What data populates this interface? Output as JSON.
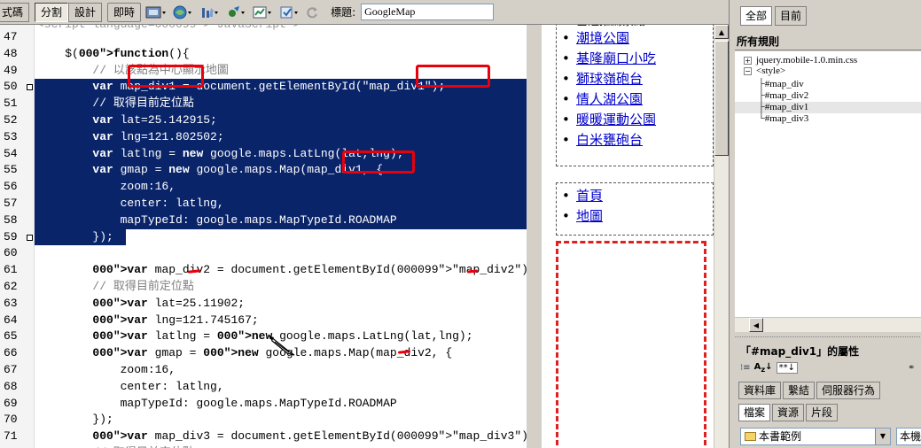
{
  "toolbar": {
    "tabs": [
      "式碼",
      "分割",
      "設計",
      "即時"
    ],
    "active_tab": "分割",
    "icons": [
      "preview-icon",
      "browser-check-icon",
      "file-management-icon",
      "debug-icon",
      "visual-aids-icon",
      "validate-icon",
      "refresh-icon"
    ],
    "title_label": "標題:",
    "title_value": "GoogleMap"
  },
  "code": {
    "cut_top_line": "<script language=\"JavaScript\">",
    "lines": [
      {
        "n": "47",
        "text": ""
      },
      {
        "n": "48",
        "text": "    $(function(){"
      },
      {
        "n": "49",
        "text": "        // 以該點為中心顯示地圖"
      },
      {
        "n": "50",
        "text": "        var map_div1 = document.getElementById(\"map_div1\");"
      },
      {
        "n": "51",
        "text": "        // 取得目前定位點"
      },
      {
        "n": "52",
        "text": "        var lat=25.142915;"
      },
      {
        "n": "53",
        "text": "        var lng=121.802502;"
      },
      {
        "n": "54",
        "text": "        var latlng = new google.maps.LatLng(lat,lng);"
      },
      {
        "n": "55",
        "text": "        var gmap = new google.maps.Map(map_div1, {"
      },
      {
        "n": "56",
        "text": "            zoom:16,"
      },
      {
        "n": "57",
        "text": "            center: latlng,"
      },
      {
        "n": "58",
        "text": "            mapTypeId: google.maps.MapTypeId.ROADMAP"
      },
      {
        "n": "59",
        "text": "        });"
      },
      {
        "n": "60",
        "text": ""
      },
      {
        "n": "61",
        "text": "        var map_div2 = document.getElementById(\"map_div2\");"
      },
      {
        "n": "62",
        "text": "        // 取得目前定位點"
      },
      {
        "n": "63",
        "text": "        var lat=25.11902;"
      },
      {
        "n": "64",
        "text": "        var lng=121.745167;"
      },
      {
        "n": "65",
        "text": "        var latlng = new google.maps.LatLng(lat,lng);"
      },
      {
        "n": "66",
        "text": "        var gmap = new google.maps.Map(map_div2, {"
      },
      {
        "n": "67",
        "text": "            zoom:16,"
      },
      {
        "n": "68",
        "text": "            center: latlng,"
      },
      {
        "n": "69",
        "text": "            mapTypeId: google.maps.MapTypeId.ROADMAP"
      },
      {
        "n": "70",
        "text": "        });"
      },
      {
        "n": "71",
        "text": "        var map_div3 = document.getElementById(\"map_div3\");"
      },
      {
        "n": "72",
        "text": "        // 取得目前定位點"
      }
    ],
    "selected_lines": [
      "50",
      "51",
      "52",
      "53",
      "54",
      "55",
      "56",
      "57",
      "58",
      "59"
    ]
  },
  "design": {
    "list1": [
      "基隆推薦景點",
      "潮境公園",
      "基隆廟口小吃",
      "獅球嶺砲台",
      "情人湖公園",
      "暖暖運動公園",
      "白米甕砲台"
    ],
    "list2": [
      "首頁",
      "地圖"
    ]
  },
  "panel": {
    "tabs": [
      "全部",
      "目前"
    ],
    "active_tab": "全部",
    "rules_header": "所有規則",
    "tree": [
      {
        "label": "jquery.mobile-1.0.min.css",
        "level": 0,
        "toggle": "+"
      },
      {
        "label": "<style>",
        "level": 0,
        "toggle": "-"
      },
      {
        "label": "#map_div",
        "level": 1
      },
      {
        "label": "#map_div2",
        "level": 1
      },
      {
        "label": "#map_div1",
        "level": 1,
        "selected": true
      },
      {
        "label": "#map_div3",
        "level": 1
      }
    ],
    "props_title": "「#map_div1」的屬性",
    "tabs_row1": [
      "資料庫",
      "繫結",
      "伺服器行為"
    ],
    "tabs_row2": [
      "檔案",
      "資源",
      "片段"
    ],
    "site_select": "本書範例",
    "view_select": "本機"
  },
  "colors": {
    "selection": "#0a246a",
    "keyword": "#000080",
    "string": "#000099",
    "comment": "#808080",
    "annotation": "#e8000d"
  }
}
